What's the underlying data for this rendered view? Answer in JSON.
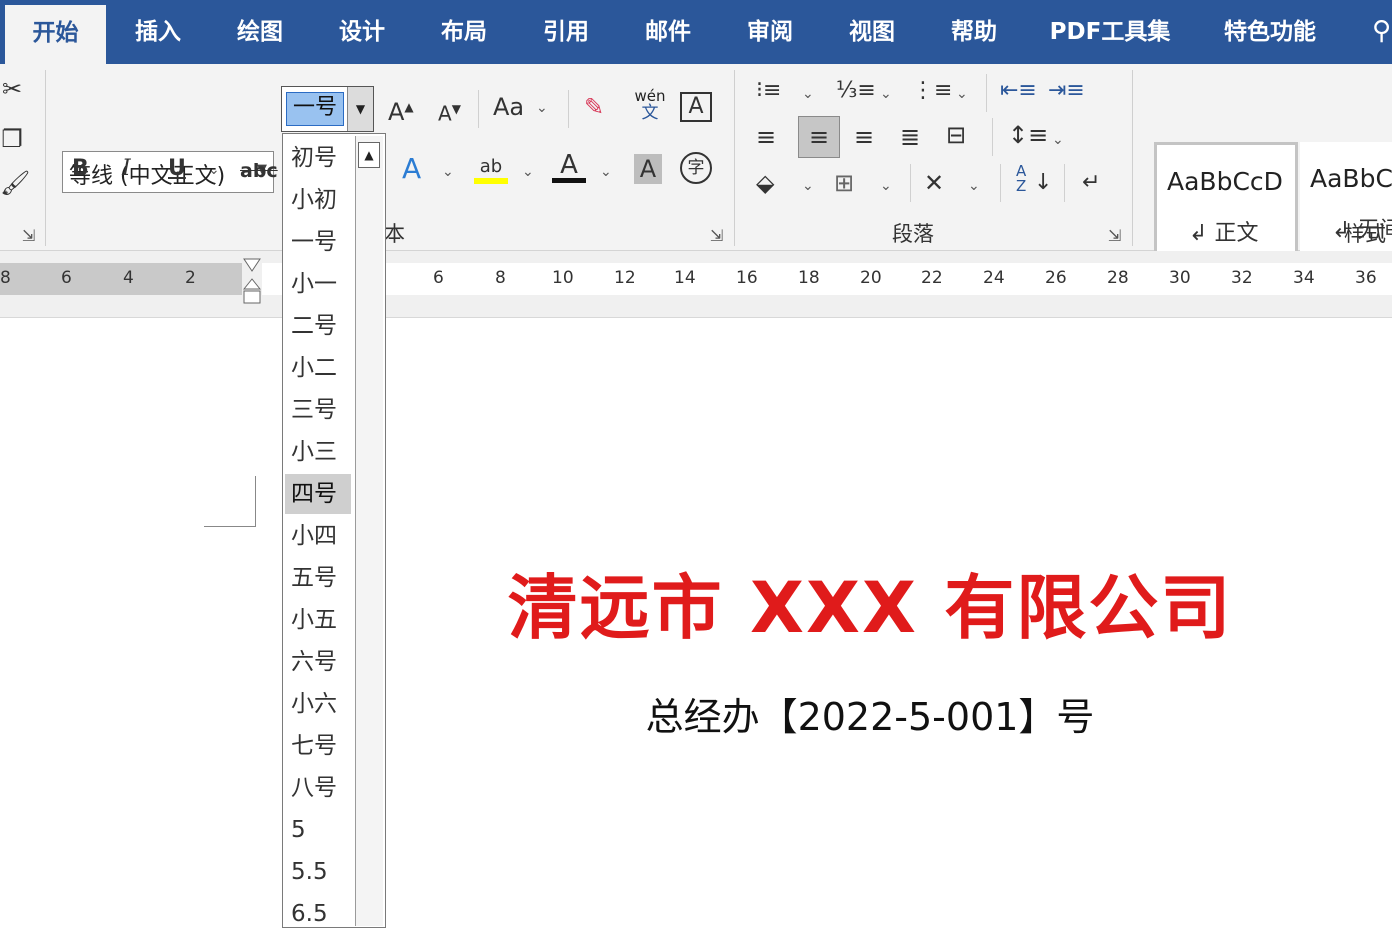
{
  "tabs": [
    {
      "label": "开始",
      "active": true
    },
    {
      "label": "插入",
      "active": false
    },
    {
      "label": "绘图",
      "active": false
    },
    {
      "label": "设计",
      "active": false
    },
    {
      "label": "布局",
      "active": false
    },
    {
      "label": "引用",
      "active": false
    },
    {
      "label": "邮件",
      "active": false
    },
    {
      "label": "审阅",
      "active": false
    },
    {
      "label": "视图",
      "active": false
    },
    {
      "label": "帮助",
      "active": false
    },
    {
      "label": "PDF工具集",
      "active": false
    },
    {
      "label": "特色功能",
      "active": false
    }
  ],
  "font": {
    "name": "等线 (中文正文)",
    "size": "一号",
    "group_label_partial": "本",
    "increase_label": "A",
    "decrease_label": "A",
    "case_label": "Aa",
    "bold": "B",
    "italic": "I",
    "underline": "U",
    "strike": "abc",
    "phonetic_top": "wén",
    "phonetic_bottom": "文",
    "border_char": "A",
    "effects_char": "A",
    "highlight_char": "ab",
    "color_char": "A",
    "shading_char": "A",
    "enclose_char": "字"
  },
  "font_size_list": [
    "初号",
    "小初",
    "一号",
    "小一",
    "二号",
    "小二",
    "三号",
    "小三",
    "四号",
    "小四",
    "五号",
    "小五",
    "六号",
    "小六",
    "七号",
    "八号",
    "5",
    "5.5",
    "6.5"
  ],
  "font_size_hover": "四号",
  "paragraph": {
    "group_label": "段落",
    "sort_top": "A",
    "sort_bottom": "Z"
  },
  "styles": {
    "group_label_partial": "样式",
    "items": [
      {
        "preview": "AaBbCcD",
        "name": "正文"
      },
      {
        "preview": "AaBbC",
        "name": "无间"
      }
    ]
  },
  "ruler": {
    "left_numbers": [
      "8",
      "6",
      "4",
      "2"
    ],
    "right_numbers": [
      "6",
      "8",
      "10",
      "12",
      "14",
      "16",
      "18",
      "20",
      "22",
      "24",
      "26",
      "28",
      "30",
      "32",
      "34",
      "36"
    ]
  },
  "document": {
    "title": "清远市 XXX 有限公司",
    "subtitle": "总经办【2022-5-001】号"
  },
  "colors": {
    "ribbon_blue": "#2b579a",
    "title_red": "#e01b1b"
  }
}
